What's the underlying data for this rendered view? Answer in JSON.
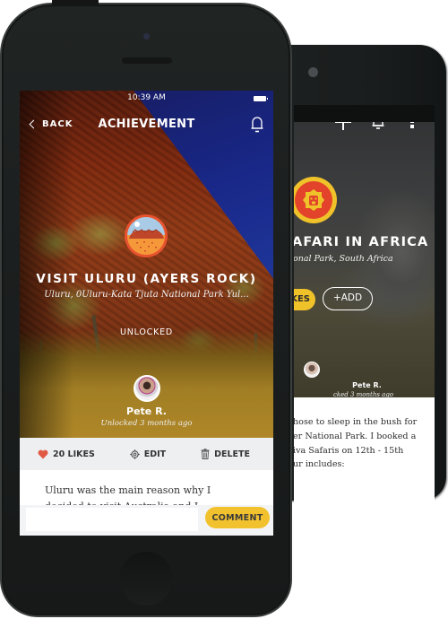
{
  "back_phone": {
    "toolbar": {
      "icons": [
        "plus-icon",
        "bell-icon",
        "more-vert-icon"
      ]
    },
    "achievement": {
      "badge_icon": "lion-icon",
      "title": "AFARI IN AFRICA",
      "location": "onal Park, South Africa"
    },
    "likes_label": "KES",
    "add_label": "+ADD",
    "user": {
      "name": "Pete R.",
      "time": "cked 3 months ago"
    },
    "description_lines": [
      "hose to sleep in the bush for",
      "er National Park. I booked a",
      "iva Safaris on 12th - 15th",
      "ur includes:"
    ]
  },
  "front_phone": {
    "status_bar": {
      "time": "10:39 AM",
      "battery_icon": "battery-icon"
    },
    "nav": {
      "back_label": "BACK",
      "title": "ACHIEVEMENT",
      "bell_icon": "bell-icon"
    },
    "achievement": {
      "badge_icon": "uluru-icon",
      "title": "VISIT ULURU (AYERS ROCK)",
      "location": "Uluru, 0Uluru-Kata Tjuta National Park Yul...",
      "status": "UNLOCKED"
    },
    "user": {
      "name": "Pete R.",
      "time": "Unlocked 3 months ago"
    },
    "actions": {
      "likes_label": "20 LIKES",
      "edit_label": "EDIT",
      "delete_label": "DELETE"
    },
    "description_lines": [
      "Uluru was the main reason why I",
      "decided to visit Australia and I"
    ],
    "comment": {
      "placeholder": "",
      "value": "",
      "button_label": "COMMENT"
    }
  },
  "colors": {
    "accent_yellow": "#f2c12e",
    "heart_red": "#e05a44",
    "badge_red": "#e2432a",
    "action_bar_bg": "#eeeff1"
  }
}
